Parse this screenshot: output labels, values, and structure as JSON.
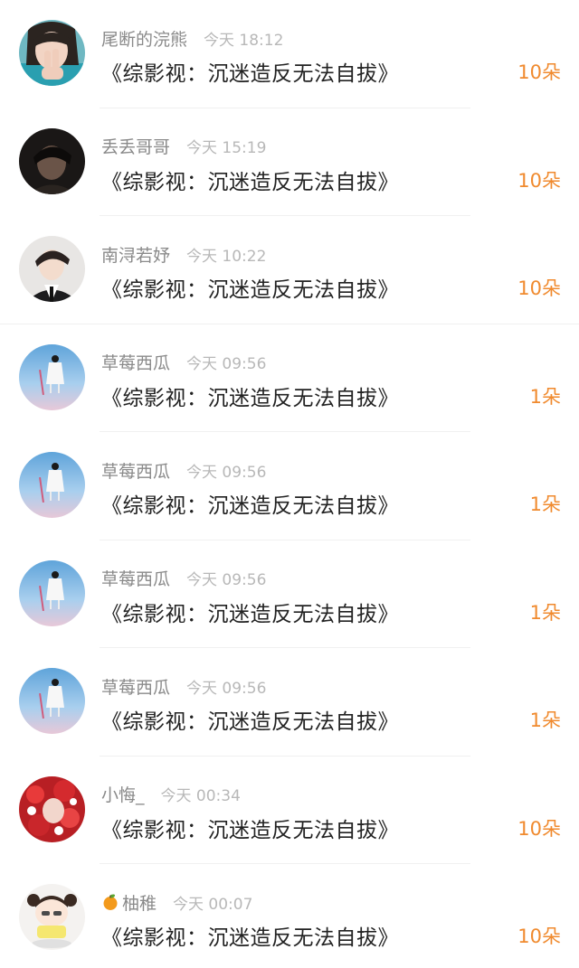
{
  "gifts": [
    {
      "name": "尾断的浣熊",
      "time": "今天 18:12",
      "title": "《综影视：沉迷造反无法自拔》",
      "amount": "10朵",
      "avatar": "avatar-girl-peace-sign"
    },
    {
      "name": "丢丢哥哥",
      "time": "今天 15:19",
      "title": "《综影视：沉迷造反无法自拔》",
      "amount": "10朵",
      "avatar": "avatar-dark-portrait"
    },
    {
      "name": "南浔若妤",
      "time": "今天 10:22",
      "title": "《综影视：沉迷造反无法自拔》",
      "amount": "10朵",
      "avatar": "avatar-man-suit"
    },
    {
      "name": "草莓西瓜",
      "time": "今天 09:56",
      "title": "《综影视：沉迷造反无法自拔》",
      "amount": "1朵",
      "avatar": "avatar-sky-figure"
    },
    {
      "name": "草莓西瓜",
      "time": "今天 09:56",
      "title": "《综影视：沉迷造反无法自拔》",
      "amount": "1朵",
      "avatar": "avatar-sky-figure"
    },
    {
      "name": "草莓西瓜",
      "time": "今天 09:56",
      "title": "《综影视：沉迷造反无法自拔》",
      "amount": "1朵",
      "avatar": "avatar-sky-figure"
    },
    {
      "name": "草莓西瓜",
      "time": "今天 09:56",
      "title": "《综影视：沉迷造反无法自拔》",
      "amount": "1朵",
      "avatar": "avatar-sky-figure"
    },
    {
      "name": "小悔_",
      "time": "今天 00:34",
      "title": "《综影视：沉迷造反无法自拔》",
      "amount": "10朵",
      "avatar": "avatar-red-flowers"
    },
    {
      "name": "柚稚",
      "time": "今天 00:07",
      "title": "《综影视：沉迷造反无法自拔》",
      "amount": "10朵",
      "avatar": "avatar-cartoon-girl",
      "name_icon": "orange-icon"
    }
  ],
  "colors": {
    "amount": "#f08a2e",
    "name": "#8a8a8a",
    "time": "#b8b8b8",
    "title": "#222222"
  }
}
